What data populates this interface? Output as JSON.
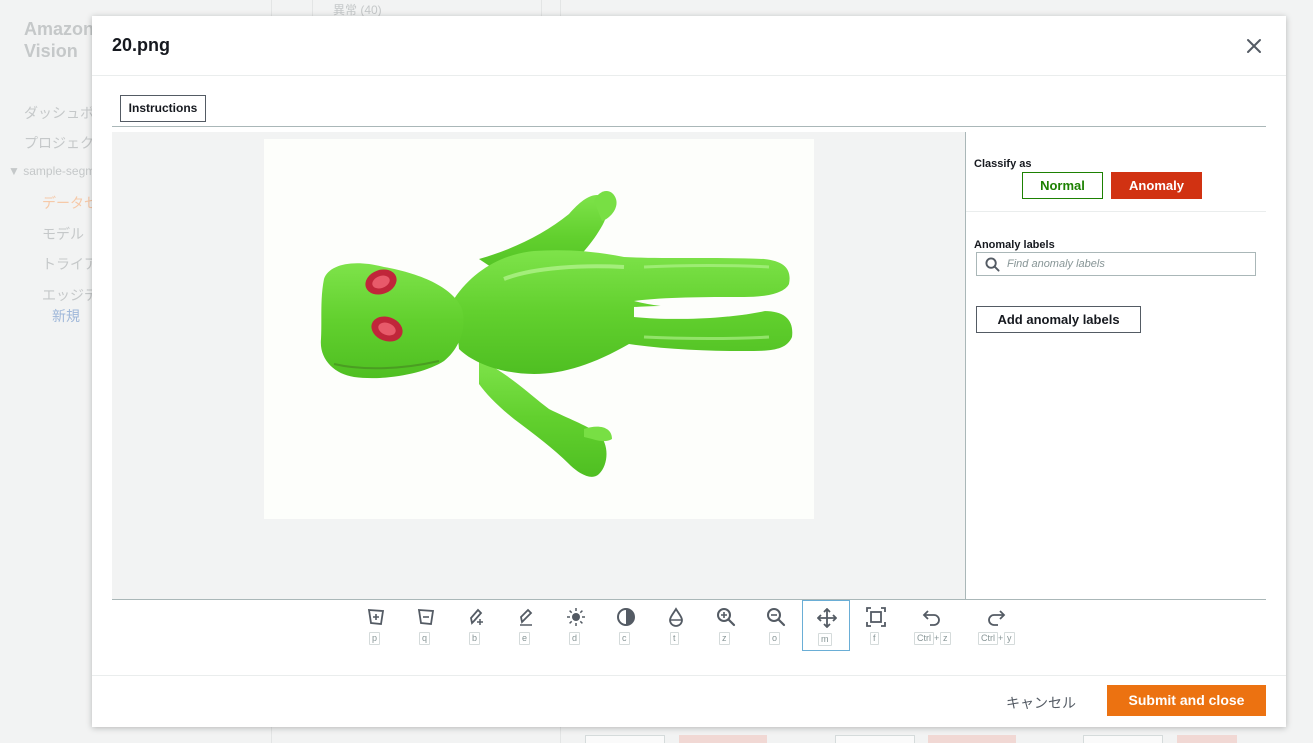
{
  "background": {
    "brand_line1": "Amazon",
    "brand_line2": "Vision",
    "nav": [
      "ダッシュボード",
      "プロジェクト",
      "sample-segmentation",
      "データセット",
      "モデル",
      "トライアル",
      "エッジデバイス",
      "新規"
    ],
    "top_tab": "異常 (40)"
  },
  "modal": {
    "title": "20.png",
    "instructions_label": "Instructions",
    "classify_heading": "Classify as",
    "normal_label": "Normal",
    "anomaly_label": "Anomaly",
    "anomaly_labels_heading": "Anomaly labels",
    "search_placeholder": "Find anomaly labels",
    "add_labels_button": "Add anomaly labels",
    "cancel_label": "キャンセル",
    "submit_label": "Submit and close"
  },
  "toolbar": [
    {
      "icon": "polygon-add-icon",
      "key": "p"
    },
    {
      "icon": "polygon-subtract-icon",
      "key": "q"
    },
    {
      "icon": "brush-add-icon",
      "key": "b"
    },
    {
      "icon": "eraser-icon",
      "key": "e"
    },
    {
      "icon": "brightness-icon",
      "key": "d"
    },
    {
      "icon": "contrast-icon",
      "key": "c"
    },
    {
      "icon": "transparency-icon",
      "key": "t"
    },
    {
      "icon": "zoom-in-icon",
      "key": "z"
    },
    {
      "icon": "zoom-out-icon",
      "key": "o"
    },
    {
      "icon": "move-icon",
      "key": "m",
      "active": true
    },
    {
      "icon": "fit-screen-icon",
      "key": "f"
    },
    {
      "icon": "undo-icon",
      "keys": [
        "Ctrl",
        "z"
      ]
    },
    {
      "icon": "redo-icon",
      "keys": [
        "Ctrl",
        "y"
      ]
    }
  ],
  "colors": {
    "normal": "#1d8102",
    "anomaly": "#d13212",
    "submit": "#ec7211",
    "figure_green": "#6fd93a",
    "figure_eye": "#c0263a"
  }
}
